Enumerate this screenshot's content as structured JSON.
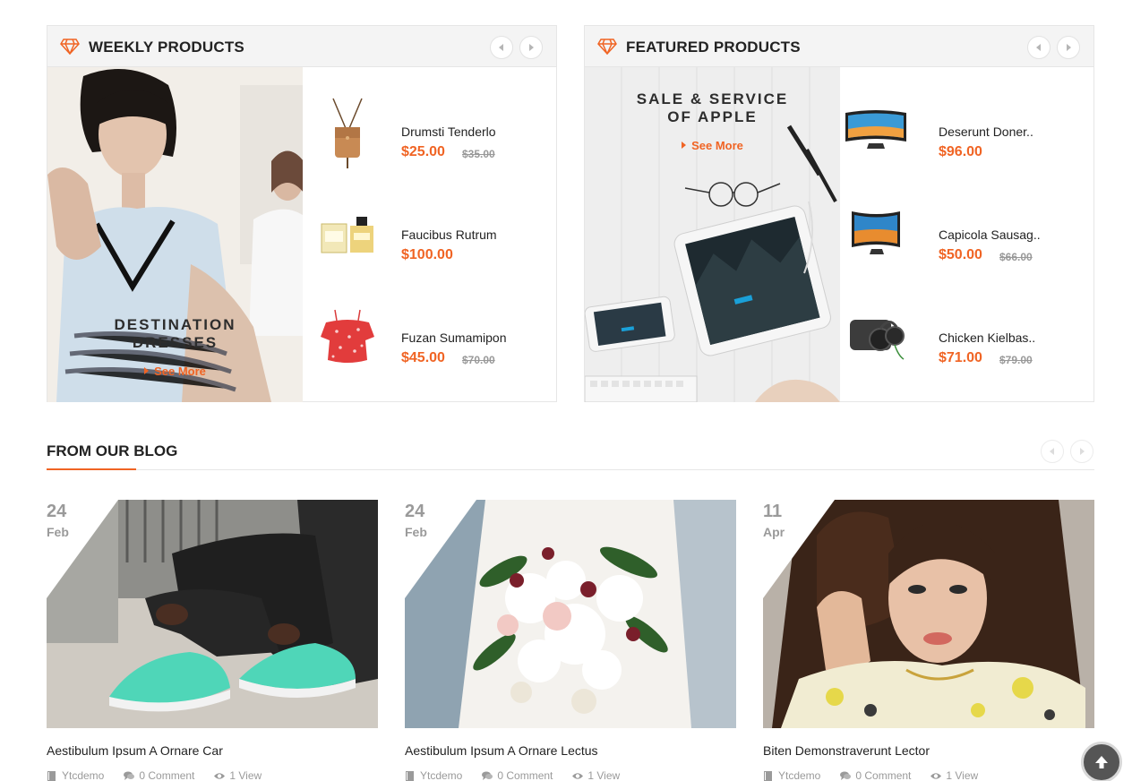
{
  "weekly": {
    "title": "WEEKLY PRODUCTS",
    "banner": {
      "line1": "DESTINATION",
      "line2": "DRESSES",
      "more": "See More"
    },
    "products": [
      {
        "name": "Drumsti Tenderlo",
        "price": "$25.00",
        "old_price": "$35.00",
        "icon": "leather-bag"
      },
      {
        "name": "Faucibus Rutrum",
        "price": "$100.00",
        "old_price": "",
        "icon": "perfume-bottle"
      },
      {
        "name": "Fuzan Sumamipon",
        "price": "$45.00",
        "old_price": "$70.00",
        "icon": "red-floral-top"
      }
    ]
  },
  "featured": {
    "title": "FEATURED PRODUCTS",
    "banner": {
      "line1": "SALE & SERVICE",
      "line2": "OF APPLE",
      "more": "See More"
    },
    "products": [
      {
        "name": "Deserunt Doner..",
        "price": "$96.00",
        "old_price": "",
        "icon": "curved-tv"
      },
      {
        "name": "Capicola Sausag..",
        "price": "$50.00",
        "old_price": "$66.00",
        "icon": "curved-tv"
      },
      {
        "name": "Chicken Kielbas..",
        "price": "$71.00",
        "old_price": "$79.00",
        "icon": "headphones"
      }
    ]
  },
  "blog": {
    "title": "FROM OUR BLOG",
    "posts": [
      {
        "day": "24",
        "month": "Feb",
        "title": "Aestibulum Ipsum A Ornare Car",
        "author": "Ytcdemo",
        "comments": "0 Comment",
        "views": "1 View",
        "image": "sneakers-photo"
      },
      {
        "day": "24",
        "month": "Feb",
        "title": "Aestibulum Ipsum A Ornare Lectus",
        "author": "Ytcdemo",
        "comments": "0 Comment",
        "views": "1 View",
        "image": "bridal-bouquet-photo"
      },
      {
        "day": "11",
        "month": "Apr",
        "title": "Biten Demonstraverunt Lector",
        "author": "Ytcdemo",
        "comments": "0 Comment",
        "views": "1 View",
        "image": "woman-portrait-photo"
      }
    ]
  },
  "colors": {
    "accent": "#f06424",
    "muted": "#9a9a9a",
    "text": "#222222"
  }
}
